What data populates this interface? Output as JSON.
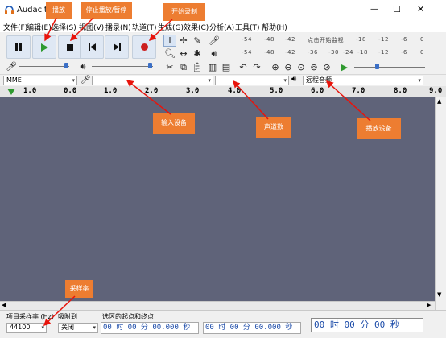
{
  "app": {
    "title": "Audacity"
  },
  "window_controls": {
    "minimize": "—",
    "maximize": "☐",
    "close": "✕"
  },
  "menu": [
    "文件(F)",
    "编辑(E)",
    "选择(S)",
    "视图(V)",
    "播录(N)",
    "轨道(T)",
    "生成(G)",
    "效果(C)",
    "分析(A)",
    "工具(T)",
    "帮助(H)"
  ],
  "meters": {
    "record_scale": [
      "-54",
      "-48",
      "-42",
      "点击开始监视",
      "-18",
      "-12",
      "-6",
      "0"
    ],
    "play_scale": [
      "-54",
      "-48",
      "-42",
      "-36",
      "-30",
      "-24",
      "-18",
      "-12",
      "-6",
      "0"
    ]
  },
  "devices": {
    "host": "MME",
    "output": "远程音频"
  },
  "ruler": {
    "ticks": [
      "1.0",
      "0.0",
      "1.0",
      "2.0",
      "3.0",
      "4.0",
      "5.0",
      "6.0",
      "7.0",
      "8.0",
      "9.0"
    ]
  },
  "selection_toolbar": {
    "project_rate_label": "项目采样率 (Hz)",
    "snap_label": "吸附到",
    "selection_label": "选区的起点和终点",
    "project_rate": "44100",
    "snap_value": "关闭",
    "start_time": "00 时 00 分 00.000 秒",
    "end_time": "00 时 00 分 00.000 秒",
    "position": "00 时 00 分 00 秒"
  },
  "annotations": {
    "play": "播放",
    "stop": "停止播放/暂停",
    "record": "开始录制",
    "input_device": "输入设备",
    "channels": "声道数",
    "playback_device": "播放设备",
    "sample_rate": "采样率"
  },
  "colors": {
    "callout": "#ed7d31",
    "track_bg": "#5f6379",
    "play_green": "#2f9a2f",
    "record_red": "#cc1f1f"
  }
}
